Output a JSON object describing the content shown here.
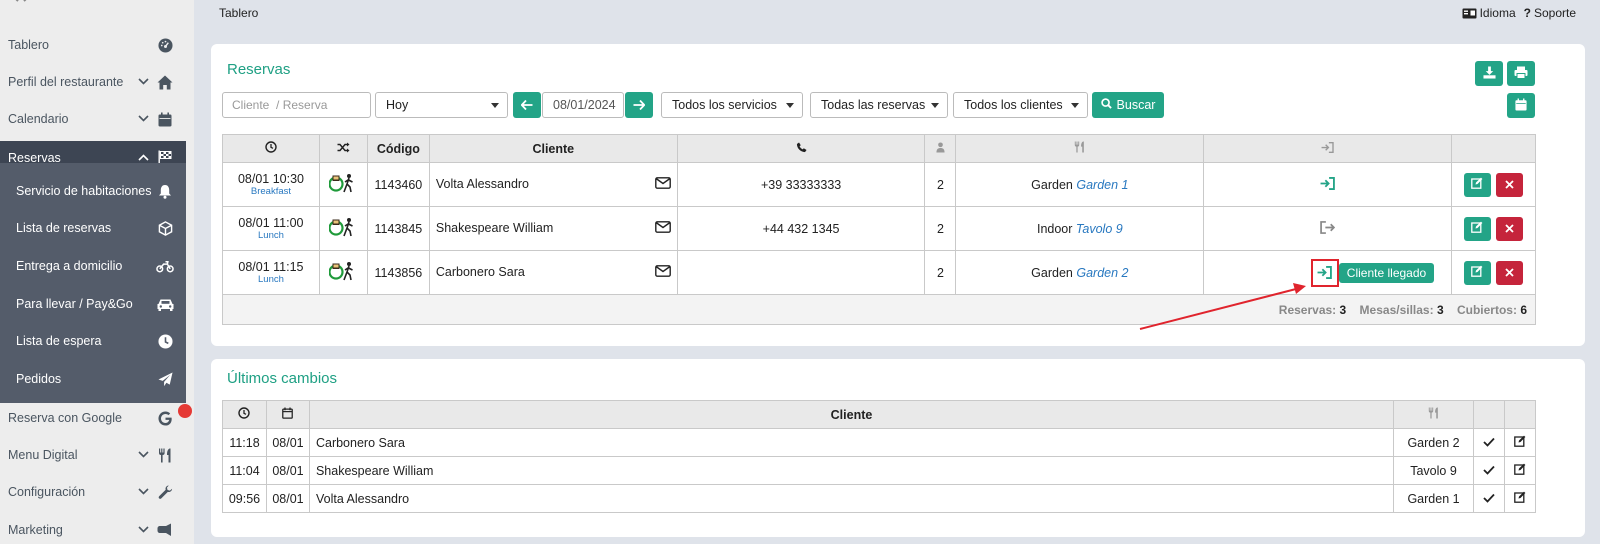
{
  "topbar": {
    "title": "Tablero",
    "language": "Idioma",
    "support": "Soporte"
  },
  "sidebar": {
    "items": [
      {
        "label": "Tablero",
        "icon": "dashboard-icon"
      },
      {
        "label": "Perfil del restaurante",
        "icon": "home-icon"
      },
      {
        "label": "Calendario",
        "icon": "calendar-icon"
      },
      {
        "label": "Reservas",
        "icon": "flag-icon"
      },
      {
        "label": "Reserva con Google",
        "icon": "google-icon"
      },
      {
        "label": "Menu Digital",
        "icon": "utensils-icon"
      },
      {
        "label": "Configuración",
        "icon": "wrench-icon"
      },
      {
        "label": "Marketing",
        "icon": "megaphone-icon"
      }
    ],
    "submenu": [
      {
        "label": "Servicio de habitaciones",
        "icon": "bell-icon"
      },
      {
        "label": "Lista de reservas",
        "icon": "cube-icon"
      },
      {
        "label": "Entrega a domicilio",
        "icon": "motorcycle-icon"
      },
      {
        "label": "Para llevar / Pay&Go",
        "icon": "car-icon"
      },
      {
        "label": "Lista de espera",
        "icon": "clock-icon"
      },
      {
        "label": "Pedidos",
        "icon": "paper-plane-icon"
      }
    ]
  },
  "reservas": {
    "title": "Reservas",
    "search_placeholder": "Cliente  / Reserva",
    "period": "Hoy",
    "date": "08/01/2024",
    "services": "Todos los servicios",
    "reservations": "Todas las reservas",
    "clients": "Todos los clientes",
    "search_button": "Buscar",
    "columns": [
      "Código",
      "Cliente"
    ],
    "rows": [
      {
        "time": "08/01 10:30",
        "service": "Breakfast",
        "code": "1143460",
        "client": "Volta Alessandro",
        "phone": "+39 33333333",
        "covers": "2",
        "zone": "Garden",
        "table": "Garden 1",
        "status": "arrived"
      },
      {
        "time": "08/01 11:00",
        "service": "Lunch",
        "code": "1143845",
        "client": "Shakespeare William",
        "phone": "+44 432 1345",
        "covers": "2",
        "zone": "Indoor",
        "table": "Tavolo 9",
        "status": "left"
      },
      {
        "time": "08/01 11:15",
        "service": "Lunch",
        "code": "1143856",
        "client": "Carbonero Sara",
        "phone": "",
        "covers": "2",
        "zone": "Garden",
        "table": "Garden 2",
        "status": "arrived"
      }
    ],
    "tooltip": "Cliente llegado",
    "summary": {
      "reservas_label": "Reservas:",
      "reservas": "3",
      "mesas_label": "Mesas/sillas:",
      "mesas": "3",
      "cubiertos_label": "Cubiertos:",
      "cubiertos": "6"
    }
  },
  "cambios": {
    "title": "Últimos cambios",
    "client_header": "Cliente",
    "rows": [
      {
        "time": "11:18",
        "date": "08/01",
        "client": "Carbonero Sara",
        "table": "Garden 2"
      },
      {
        "time": "11:04",
        "date": "08/01",
        "client": "Shakespeare William",
        "table": "Tavolo 9"
      },
      {
        "time": "09:56",
        "date": "08/01",
        "client": "Volta Alessandro",
        "table": "Garden 1"
      }
    ]
  },
  "colors": {
    "accent": "#23a487",
    "danger": "#c5243b",
    "sidebar_active": "#3d4553",
    "submenu": "#545c6a",
    "link": "#2878c0"
  }
}
